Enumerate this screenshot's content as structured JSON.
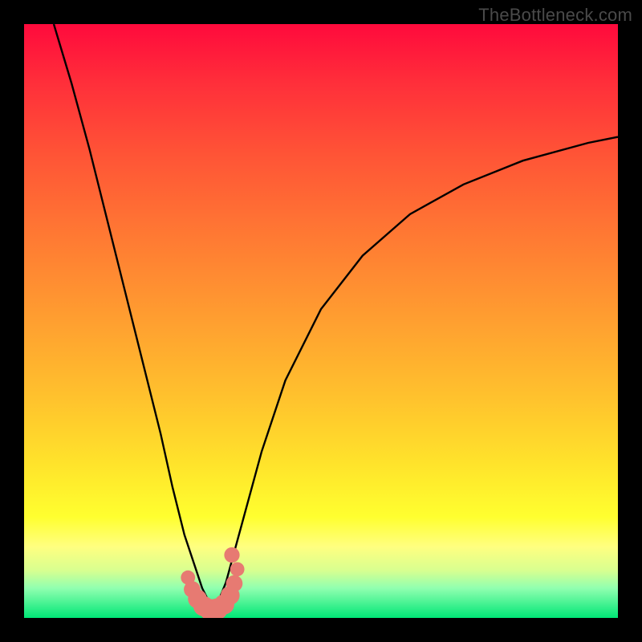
{
  "watermark": "TheBottleneck.com",
  "colors": {
    "frame_background": "#000000",
    "gradient_top": "#ff0a3c",
    "gradient_mid1": "#ff7a33",
    "gradient_mid2": "#ffe32b",
    "gradient_bottom": "#00e676",
    "curve_stroke": "#000000",
    "marker_fill": "#e77a72",
    "watermark_color": "#4a4a4a"
  },
  "chart_data": {
    "type": "line",
    "title": "",
    "xlabel": "",
    "ylabel": "",
    "xlim": [
      0,
      100
    ],
    "ylim": [
      0,
      100
    ],
    "grid": false,
    "legend": false,
    "annotations": [],
    "series": [
      {
        "name": "bottleneck-curve-left",
        "x": [
          5,
          8,
          11,
          14,
          17,
          20,
          23,
          25,
          27,
          30,
          32
        ],
        "y": [
          100,
          90,
          79,
          67,
          55,
          43,
          31,
          22,
          14,
          5,
          1
        ]
      },
      {
        "name": "bottleneck-curve-right",
        "x": [
          32,
          34,
          37,
          40,
          44,
          50,
          57,
          65,
          74,
          84,
          95,
          100
        ],
        "y": [
          1,
          6,
          17,
          28,
          40,
          52,
          61,
          68,
          73,
          77,
          80,
          81
        ]
      }
    ],
    "markers": {
      "name": "highlight-band",
      "x": [
        27.6,
        28.3,
        29.2,
        30.2,
        31.3,
        32.5,
        33.7,
        34.7,
        35.4,
        35.9,
        35.0
      ],
      "y": [
        6.8,
        4.8,
        3.2,
        2.0,
        1.4,
        1.5,
        2.3,
        3.8,
        5.8,
        8.2,
        10.6
      ],
      "r": [
        1.2,
        1.4,
        1.6,
        1.7,
        1.8,
        1.8,
        1.7,
        1.6,
        1.4,
        1.2,
        1.3
      ]
    }
  }
}
